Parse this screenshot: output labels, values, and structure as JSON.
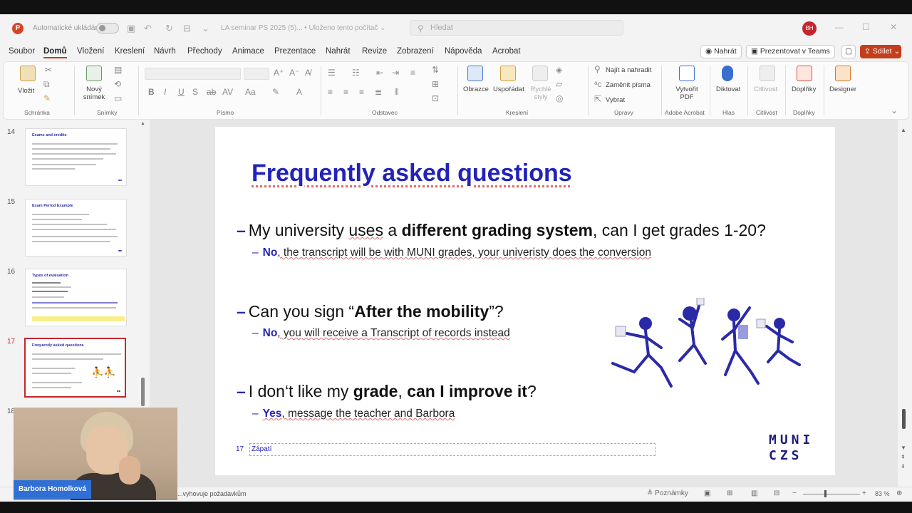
{
  "titlebar": {
    "app_icon": "powerpoint-icon",
    "autosave_label": "Automatické ukládání",
    "document_title": "LA seminar PS 2025 (5)... • Uloženo tento počítač ⌄",
    "search_placeholder": "Hledat",
    "user_initials": "BH"
  },
  "menu": {
    "tabs": [
      "Soubor",
      "Domů",
      "Vložení",
      "Kreslení",
      "Návrh",
      "Přechody",
      "Animace",
      "Prezentace",
      "Nahrát",
      "Revize",
      "Zobrazení",
      "Nápověda",
      "Acrobat"
    ],
    "active_tab": "Domů",
    "record_label": "Nahrát",
    "teams_label": "Prezentovat v Teams",
    "share_label": "Sdílet"
  },
  "ribbon": {
    "paste_label": "Vložit",
    "clipboard_group": "Schránka",
    "new_slide_label": "Nový snímek",
    "slides_group": "Snímky",
    "font_group": "Písmo",
    "paragraph_group": "Odstavec",
    "shapes_label": "Obrazce",
    "arrange_label": "Uspořádat",
    "quick_styles_label": "Rychlé styly",
    "drawing_group": "Kreslení",
    "find_replace_label": "Najít a nahradit",
    "replace_fonts_label": "Zaměnit písma",
    "select_label": "Vybrat",
    "editing_group": "Úpravy",
    "create_pdf_label": "Vytvořit PDF",
    "acrobat_group": "Adobe Acrobat",
    "dictate_label": "Diktovat",
    "voice_group": "Hlas",
    "sensitivity_label": "Citlivost",
    "sensitivity_group": "Citlivost",
    "addins_label": "Doplňky",
    "addins_group": "Doplňky",
    "designer_label": "Designer"
  },
  "thumbnails": [
    {
      "num": "14",
      "title": "Exams and credits"
    },
    {
      "num": "15",
      "title": "Exam Period Example"
    },
    {
      "num": "16",
      "title": "Types of evaluation"
    },
    {
      "num": "17",
      "title": "Frequently asked questions"
    },
    {
      "num": "18",
      "title": ""
    }
  ],
  "slide": {
    "title": "Frequently asked questions",
    "q1": {
      "pre": "My university ",
      "u1": "uses",
      "mid": " a ",
      "bold": "different grading system",
      "post": ", can I get grades 1-20?"
    },
    "a1": {
      "strong": "No",
      "text": ", the transcript will be with MUNI grades, your univeristy does the conversion"
    },
    "q2": {
      "pre": "Can you sign “",
      "bold": "After the mobility",
      "post": "”?"
    },
    "a2": {
      "strong": "No",
      "text": ", you will receive a Transcript of records instead"
    },
    "q3": {
      "pre": "I don‘t like my ",
      "bold1": "grade",
      "mid": ", ",
      "bold2": "can I improve it",
      "post": "?"
    },
    "a3": {
      "strong": "Yes",
      "text": ", message the teacher and Barbora"
    },
    "footer_number": "17",
    "footer_text": "Zápatí",
    "logo_line1": "MUNI",
    "logo_line2": "CZS"
  },
  "statusbar": {
    "text": "...vyhovuje požadavkům",
    "notes_label": "Poznámky",
    "zoom": "83 %"
  },
  "webcam": {
    "name": "Barbora Homolková"
  },
  "colors": {
    "accent": "#c43e1c",
    "slide_blue": "#2323b8",
    "selection": "#c4262e"
  }
}
